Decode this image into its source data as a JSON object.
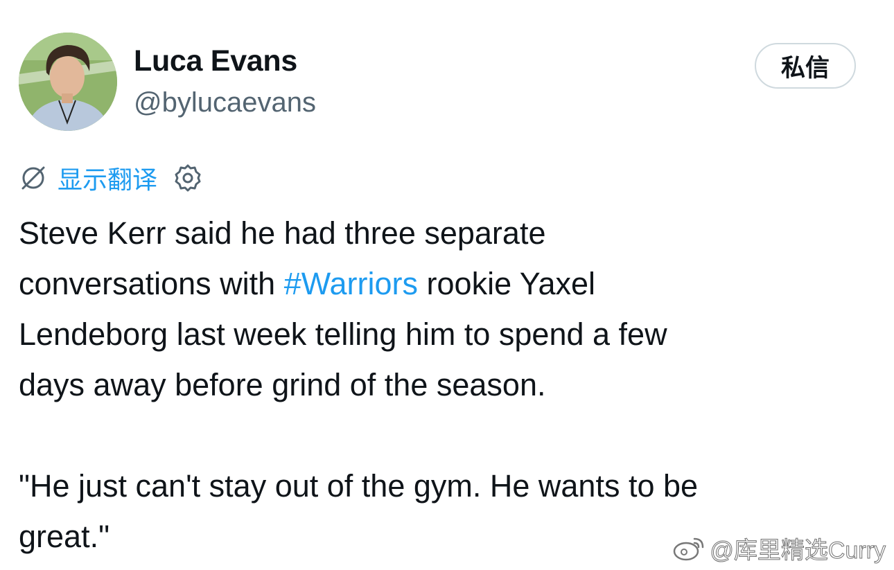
{
  "author": {
    "display_name": "Luca Evans",
    "handle": "@bylucaevans",
    "avatar_icon": "profile-photo"
  },
  "actions": {
    "dm_label": "私信"
  },
  "translate": {
    "icon": "globe-slash-icon",
    "label": "显示翻译",
    "settings_icon": "gear-icon"
  },
  "tweet": {
    "line1": "Steve Kerr said he had three separate",
    "line2_before": "conversations with ",
    "hashtag": "#Warriors",
    "line2_after": " rookie Yaxel",
    "line3": "Lendeborg last week telling him to spend a few",
    "line4": "days away before grind of the season.",
    "quote_line1": "\"He just can't stay out of the gym. He wants to be",
    "quote_line2": "great.\""
  },
  "colors": {
    "link": "#1d9bf0",
    "text": "#0f1419",
    "secondary": "#536471",
    "border": "#cfd9de"
  },
  "watermark": {
    "icon": "weibo-logo-icon",
    "text": "@库里精选Curry"
  }
}
